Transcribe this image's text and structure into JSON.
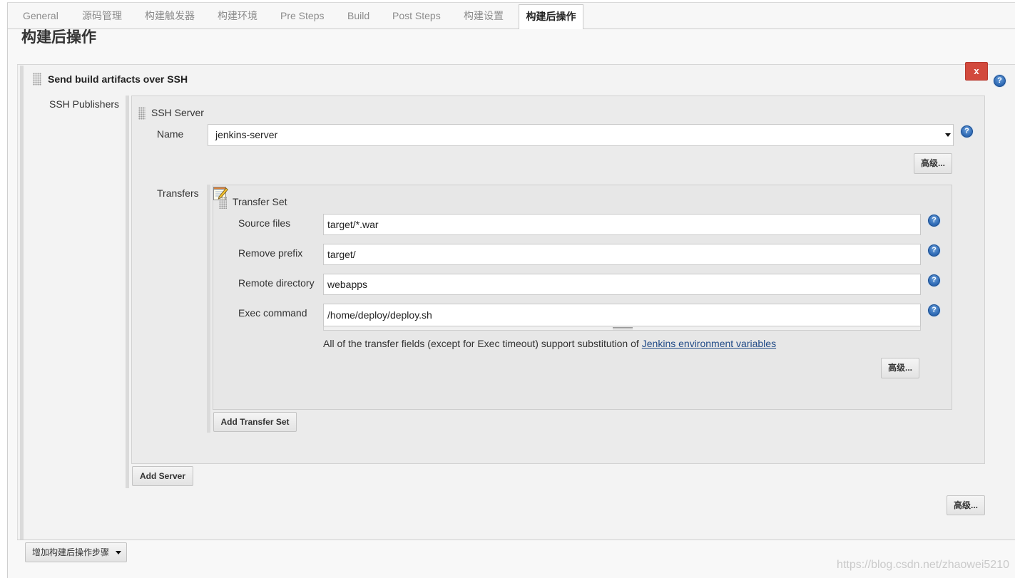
{
  "tabs": [
    {
      "label": "General",
      "active": false
    },
    {
      "label": "源码管理",
      "active": false
    },
    {
      "label": "构建触发器",
      "active": false
    },
    {
      "label": "构建环境",
      "active": false
    },
    {
      "label": "Pre Steps",
      "active": false
    },
    {
      "label": "Build",
      "active": false
    },
    {
      "label": "Post Steps",
      "active": false
    },
    {
      "label": "构建设置",
      "active": false
    },
    {
      "label": "构建后操作",
      "active": true
    }
  ],
  "page_title": "构建后操作",
  "help_glyph": "?",
  "publisher": {
    "title": "Send build artifacts over SSH",
    "delete_label": "x",
    "ssh_publishers_label": "SSH Publishers",
    "server": {
      "title": "SSH Server",
      "name_label": "Name",
      "name_value": "jenkins-server",
      "advanced_label": "高级...",
      "transfers_label": "Transfers",
      "transfer_set": {
        "title": "Transfer Set",
        "source_files": {
          "label": "Source files",
          "value": "target/*.war"
        },
        "remove_prefix": {
          "label": "Remove prefix",
          "value": "target/"
        },
        "remote_directory": {
          "label": "Remote directory",
          "value": "webapps"
        },
        "exec_command": {
          "label": "Exec command",
          "value": "/home/deploy/deploy.sh"
        },
        "note_text": "All of the transfer fields (except for Exec timeout) support substitution of",
        "note_link": "Jenkins environment variables",
        "advanced_label": "高级..."
      },
      "add_transfer_set_label": "Add Transfer Set"
    },
    "add_server_label": "Add Server",
    "advanced_label": "高级..."
  },
  "add_post_build_step_label": "增加构建后操作步骤",
  "watermark": "https://blog.csdn.net/zhaowei5210",
  "icons": {
    "drag_handle": "grip-icon",
    "help": "help-icon",
    "delete": "close-icon",
    "notepad": "notepad-edit-icon",
    "dropdown": "chevron-down-icon"
  },
  "colors": {
    "delete_button": "#d24a3d",
    "help_icon": "#2c67b2",
    "link": "#204a87",
    "active_tab": "#ffffff"
  }
}
